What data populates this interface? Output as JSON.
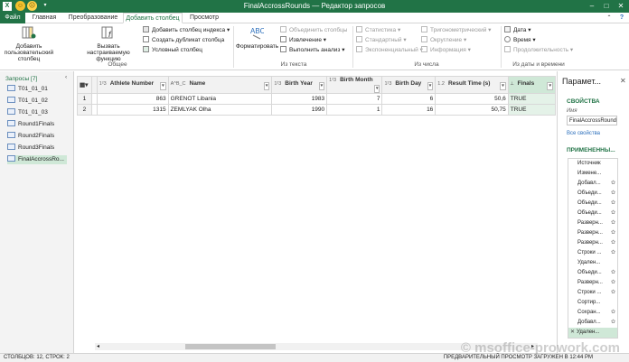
{
  "window": {
    "title": "FinalAccrossRounds — Редактор запросов",
    "app_icon": "X",
    "colors": {
      "accent": "#217346",
      "selection": "#cfe8d7"
    }
  },
  "tabs": [
    {
      "label": "Файл"
    },
    {
      "label": "Главная"
    },
    {
      "label": "Преобразование"
    },
    {
      "label": "Добавить столбец"
    },
    {
      "label": "Просмотр"
    }
  ],
  "ribbon": {
    "custom_column": "Добавить пользовательский столбец",
    "invoke_function": "Вызвать настраиваемую функцию",
    "index_column": "Добавить столбец индекса",
    "duplicate_column": "Создать дубликат столбца",
    "conditional_column": "Условный столбец",
    "group_general": "Общее",
    "format": "Форматировать",
    "merge_columns": "Объединить столбцы",
    "extract": "Извлечение",
    "parse": "Выполнить анализ",
    "group_text": "Из текста",
    "statistics": "Статистика",
    "standard": "Стандартный",
    "exponent": "Экспоненциальный",
    "trig": "Тригонометрический",
    "rounding": "Округление",
    "information": "Информация",
    "group_number": "Из числа",
    "date": "Дата",
    "time": "Время",
    "duration": "Продолжительность",
    "group_datetime": "Из даты и времени"
  },
  "queries": {
    "header": "Запросы [7]",
    "items": [
      {
        "label": "T01_01_01"
      },
      {
        "label": "T01_01_02"
      },
      {
        "label": "T01_01_03"
      },
      {
        "label": "Round1Finals"
      },
      {
        "label": "Round2Finals"
      },
      {
        "label": "Round3Finals"
      },
      {
        "label": "FinalAccrossRo..."
      }
    ]
  },
  "table": {
    "columns": [
      {
        "type": "1²3",
        "name": "Athlete Number"
      },
      {
        "type": "A^B_C",
        "name": "Name"
      },
      {
        "type": "1²3",
        "name": "Birth Year"
      },
      {
        "type": "1²3",
        "name": "Birth Month"
      },
      {
        "type": "1²3",
        "name": "Birth Day"
      },
      {
        "type": "1.2",
        "name": "Result Time (s)"
      },
      {
        "type": "⟂",
        "name": "Finals"
      }
    ],
    "rows": [
      {
        "n": "1",
        "c": [
          "863",
          "GRENOT Libania",
          "1983",
          "7",
          "6",
          "50,6",
          "TRUE"
        ]
      },
      {
        "n": "2",
        "c": [
          "1315",
          "ZEMLYAK Olha",
          "1990",
          "1",
          "16",
          "50,75",
          "TRUE"
        ]
      }
    ]
  },
  "settings": {
    "title": "Парамет...",
    "properties": "СВОЙСТВА",
    "name_label": "Имя",
    "name_value": "FinalAccrossRounds",
    "all_props": "Все свойства",
    "applied": "ПРИМЕНЕННЫ...",
    "steps": [
      {
        "label": "Источник",
        "gear": false
      },
      {
        "label": "Измене...",
        "gear": false
      },
      {
        "label": "Добавл...",
        "gear": true
      },
      {
        "label": "Объеди...",
        "gear": true
      },
      {
        "label": "Объеди...",
        "gear": true
      },
      {
        "label": "Объеди...",
        "gear": true
      },
      {
        "label": "Разверн...",
        "gear": true
      },
      {
        "label": "Разверн...",
        "gear": true
      },
      {
        "label": "Разверн...",
        "gear": true
      },
      {
        "label": "Строки ...",
        "gear": true
      },
      {
        "label": "Удален...",
        "gear": false
      },
      {
        "label": "Объеди...",
        "gear": true
      },
      {
        "label": "Разверн...",
        "gear": true
      },
      {
        "label": "Строки ...",
        "gear": true
      },
      {
        "label": "Сортир...",
        "gear": false
      },
      {
        "label": "Сохран...",
        "gear": true
      },
      {
        "label": "Добавл...",
        "gear": true
      },
      {
        "label": "Удален...",
        "gear": false
      }
    ]
  },
  "status": {
    "left": "СТОЛБЦОВ: 12, СТРОК: 2",
    "right": "ПРЕДВАРИТЕЛЬНЫЙ ПРОСМОТР ЗАГРУЖЕН В 12:44 PM"
  },
  "watermark": "© msoffice-prowork.com"
}
